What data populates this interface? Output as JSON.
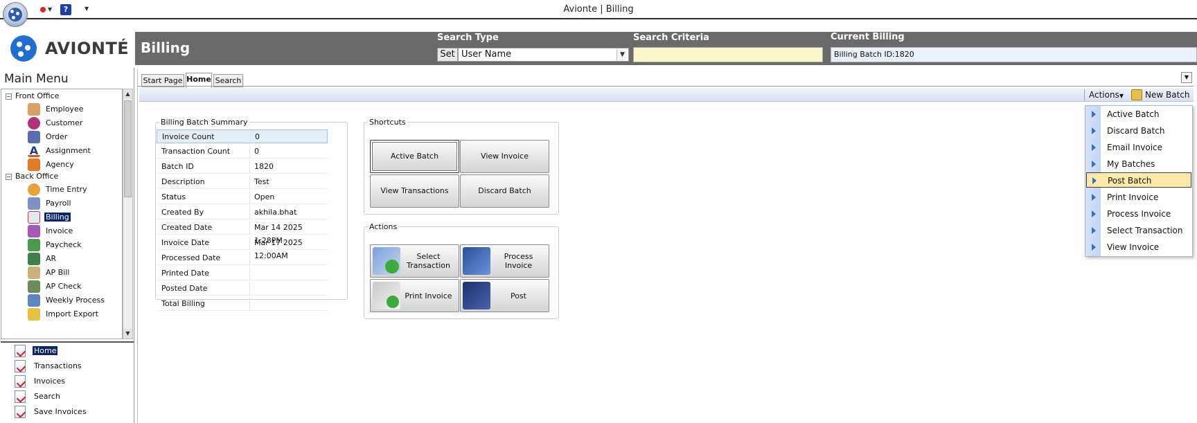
{
  "window": {
    "title": "Avionte | Billing"
  },
  "brand": {
    "name": "AVIONTÉ"
  },
  "header": {
    "page_title": "Billing",
    "search_type_label": "Search Type",
    "set_label": "Set",
    "search_type_value": "User Name",
    "search_criteria_label": "Search Criteria",
    "search_criteria_value": "",
    "current_billing_label": "Current Billing",
    "current_billing_value": "Billing Batch ID:1820"
  },
  "sidebar": {
    "title": "Main Menu",
    "front_office": {
      "label": "Front Office",
      "items": [
        "Employee",
        "Customer",
        "Order",
        "Assignment",
        "Agency"
      ]
    },
    "back_office": {
      "label": "Back Office",
      "items": [
        "Time Entry",
        "Payroll",
        "Billing",
        "Invoice",
        "Paycheck",
        "AR",
        "AP Bill",
        "AP Check",
        "Weekly Process",
        "Import Export"
      ]
    },
    "sub_items": [
      "Home",
      "Transactions",
      "Invoices",
      "Search",
      "Save Invoices"
    ]
  },
  "tabs": [
    "Start Page",
    "Home",
    "Search"
  ],
  "toolbar": {
    "actions_label": "Actions",
    "new_batch_label": "New Batch"
  },
  "summary": {
    "title": "Billing Batch Summary",
    "rows": [
      {
        "k": "Invoice Count",
        "v": "0"
      },
      {
        "k": "Transaction Count",
        "v": "0"
      },
      {
        "k": "Batch ID",
        "v": "1820"
      },
      {
        "k": "Description",
        "v": "Test"
      },
      {
        "k": "Status",
        "v": "Open"
      },
      {
        "k": "Created By",
        "v": "akhila.bhat"
      },
      {
        "k": "Created Date",
        "v": "Mar 14 2025  1:28PM"
      },
      {
        "k": "Invoice Date",
        "v": "Mar 17 2025 12:00AM"
      },
      {
        "k": "Processed Date",
        "v": ""
      },
      {
        "k": "Printed Date",
        "v": ""
      },
      {
        "k": "Posted Date",
        "v": ""
      },
      {
        "k": "Total Billing",
        "v": ""
      }
    ]
  },
  "shortcuts": {
    "title": "Shortcuts",
    "buttons": [
      "Active Batch",
      "View Invoice",
      "View Transactions",
      "Discard Batch"
    ]
  },
  "actions_group": {
    "title": "Actions",
    "buttons": [
      "Select Transaction",
      "Process Invoice",
      "Print Invoice",
      "Post"
    ]
  },
  "actions_menu": {
    "items": [
      "Active Batch",
      "Discard Batch",
      "Email Invoice",
      "My Batches",
      "Post Batch",
      "Print Invoice",
      "Process Invoice",
      "Select Transaction",
      "View Invoice"
    ],
    "highlighted": "Post Batch"
  },
  "colors": {
    "header_bg": "#6a6a6a",
    "brand_blue": "#1e6fd0",
    "selection_bg": "#0a246a",
    "menu_highlight": "#fde9a8",
    "criteria_bg": "#fbf5c9"
  }
}
